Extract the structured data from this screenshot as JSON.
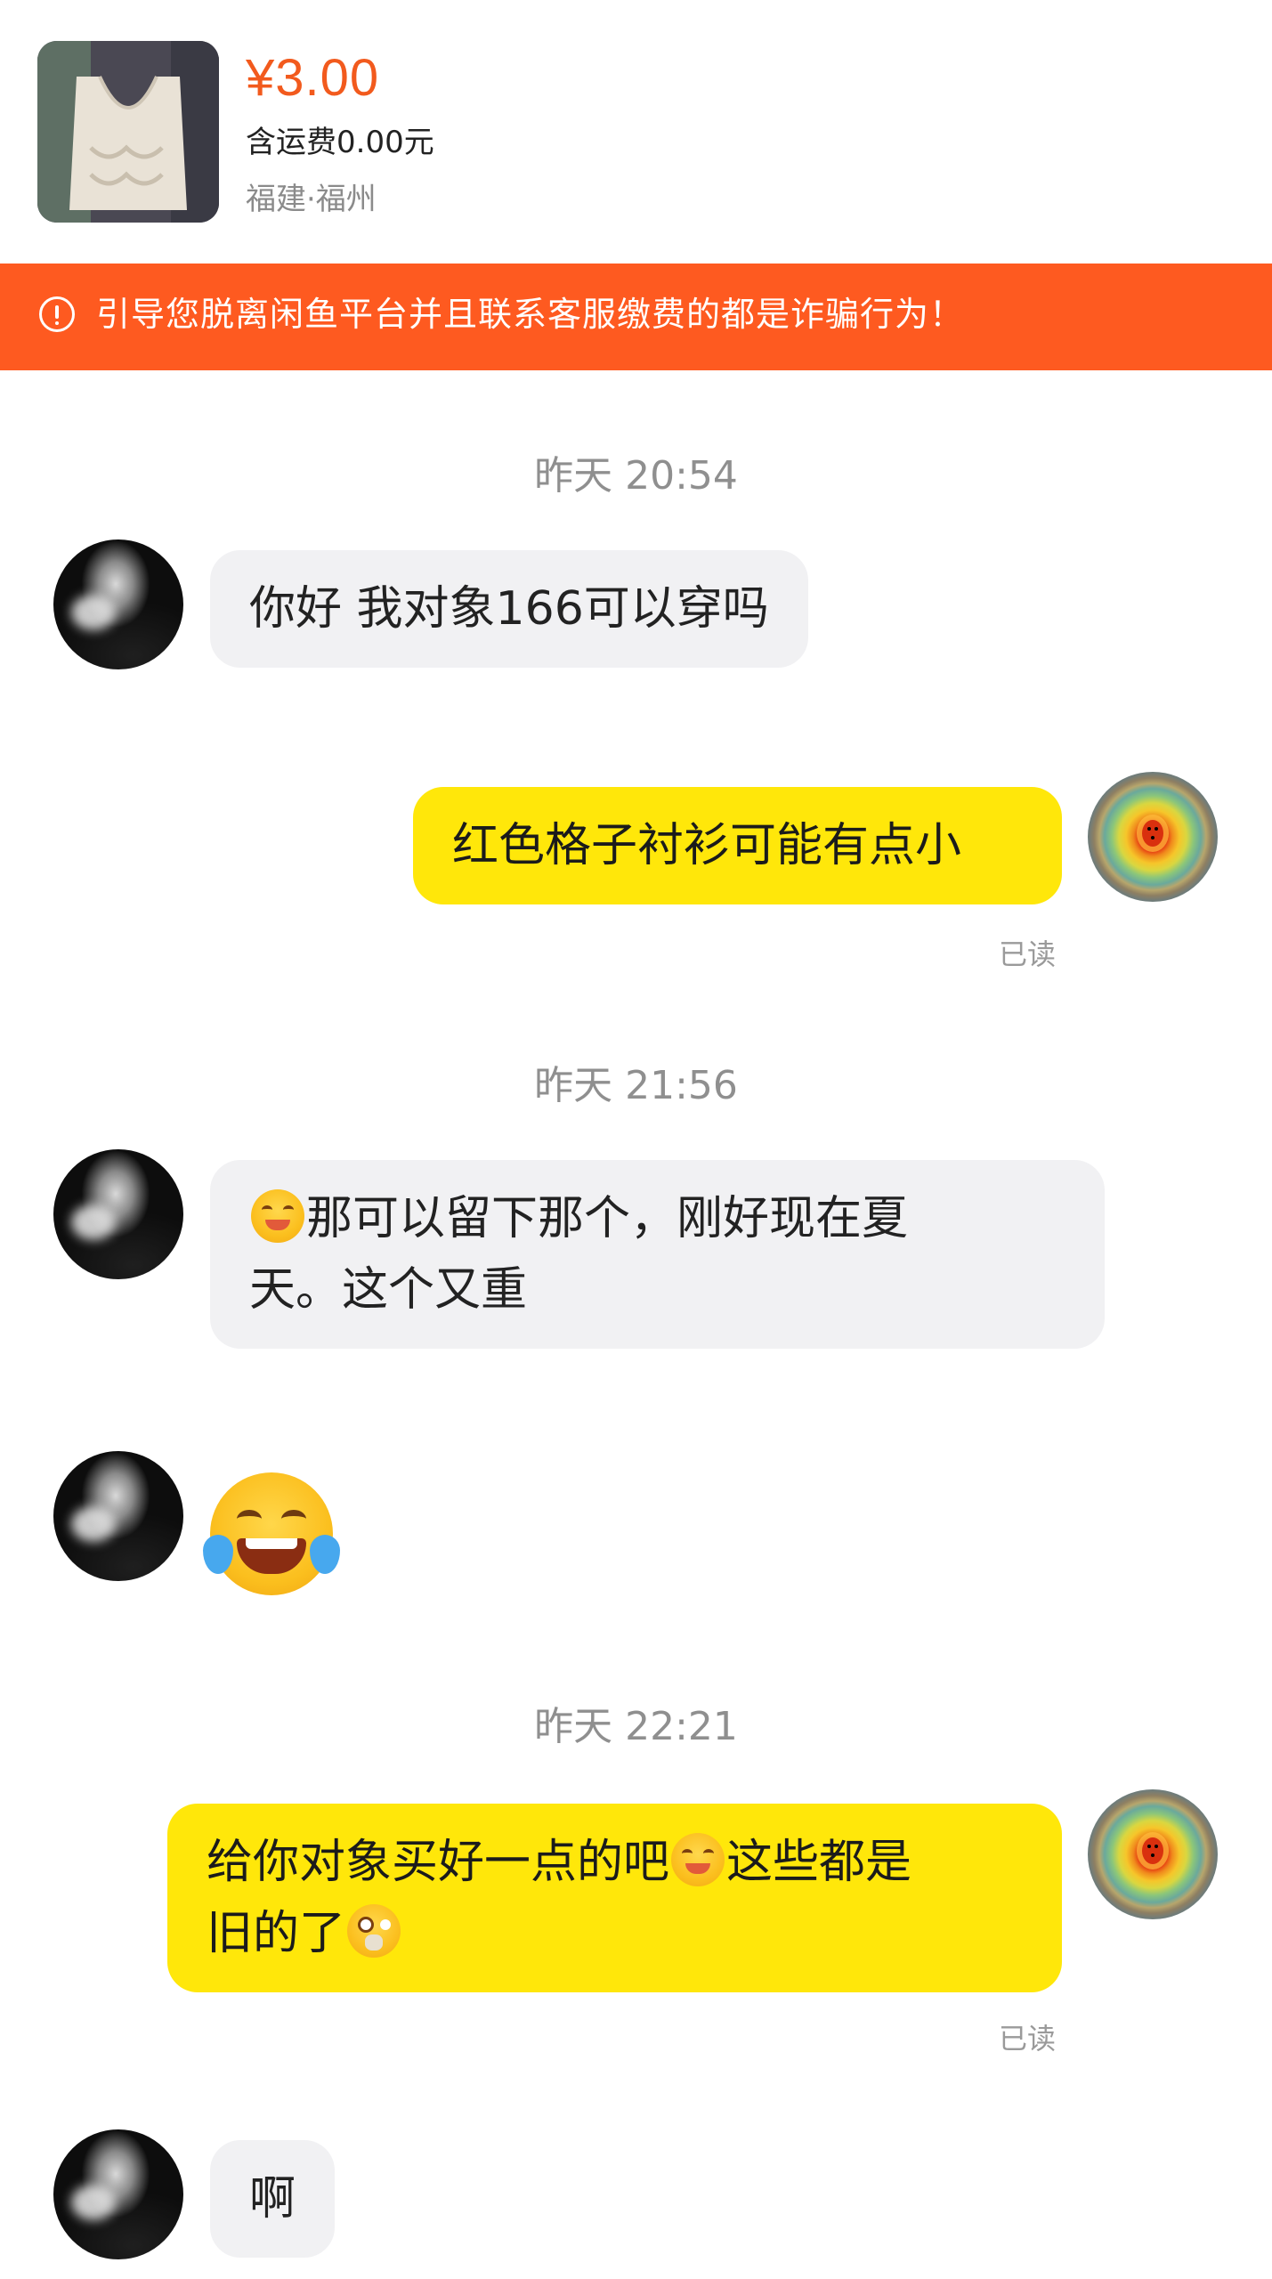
{
  "product": {
    "price": "¥3.00",
    "shipping": "含运费0.00元",
    "location": "福建·福州"
  },
  "banner": {
    "icon": "alert-circle-icon",
    "text": "引导您脱离闲鱼平台并且联系客服缴费的都是诈骗行为！"
  },
  "chat": {
    "timestamps": [
      "昨天 20:54",
      "昨天 21:56",
      "昨天 22:21"
    ],
    "msg1": "你好 我对象166可以穿吗",
    "msg2": "红色格子衬衫可能有点小",
    "msg2_read": "已读",
    "msg3_line1": "那可以留下那个，刚好现在夏",
    "msg3_line2": "天。这个又重",
    "msg4_emoji": "laughing-tears-emoji",
    "msg5_part1": "给你对象买好一点的吧",
    "msg5_part2": "这些都是",
    "msg5_line2": "旧的了",
    "msg5_read": "已读",
    "msg6": "啊"
  },
  "colors": {
    "accent": "#fe5a20",
    "price": "#f25a1d",
    "my_bubble": "#ffe70a",
    "other_bubble": "#f1f1f3"
  }
}
